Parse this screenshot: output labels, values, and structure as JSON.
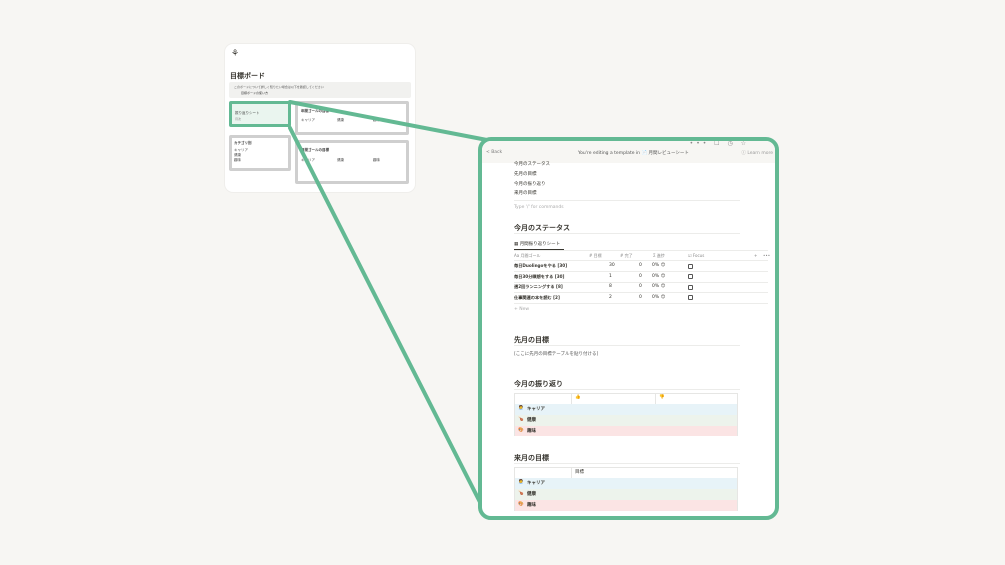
{
  "thumbnail": {
    "logo": "⚘",
    "title": "目標ボード",
    "callout_text": "このボードについて詳しく知りたい場合は以下を確認してください",
    "callout_link": "目標ボードの使い方",
    "review_label": "振り返りシート",
    "review_sub": "月次",
    "annual_title": "年間ゴールの目標",
    "category_title": "カテゴリ別",
    "annual_items": [
      "キャリア",
      "健康",
      "趣味"
    ],
    "category_items": [
      "キャリア",
      "健康",
      "趣味"
    ],
    "monthly_title": "月間ゴールの目標"
  },
  "zoom": {
    "topbar": {
      "icons": "•••  ☐  ◷  ☆",
      "back": "< Back",
      "notice_prefix": "You're editing a template in",
      "template_icon": "📄",
      "template_name": "月間レビューシート",
      "learn_more": "ⓘ Learn more"
    },
    "toc": [
      "今月のステータス",
      "先月の目標",
      "今月の振り返り",
      "来月の目標"
    ],
    "command_placeholder": "Type '/' for commands",
    "status_section": {
      "heading": "今月のステータス",
      "tab_label": "月間振り返りシート",
      "columns": [
        "Aa 月間ゴール",
        "# 目標",
        "# 完了",
        "Σ 進捗",
        "☑ Focus"
      ],
      "rows": [
        {
          "goal": "毎日Duolingoをやる [30]",
          "target": "30",
          "done": "0",
          "progress": "0% 😊"
        },
        {
          "goal": "毎日30分瞑想をする [30]",
          "target": "1",
          "done": "0",
          "progress": "0% 😊"
        },
        {
          "goal": "週2回ランニングする [8]",
          "target": "8",
          "done": "0",
          "progress": "0% 😊"
        },
        {
          "goal": "仕事関連の本を読む [2]",
          "target": "2",
          "done": "0",
          "progress": "0% 😊"
        }
      ],
      "new_label": "+ New",
      "add_col": "+",
      "more": "•••"
    },
    "last_month": {
      "heading": "先月の目標",
      "placeholder": "[ここに先月の目標テーブルを貼り付ける]"
    },
    "reflection": {
      "heading": "今月の振り返り",
      "col_good": "👍",
      "col_bad": "👎",
      "rows": [
        {
          "icon": "🧑‍💼",
          "label": "キャリア"
        },
        {
          "icon": "🍗",
          "label": "健康"
        },
        {
          "icon": "🎨",
          "label": "趣味"
        }
      ]
    },
    "next_month": {
      "heading": "来月の目標",
      "col_goal": "目標",
      "rows": [
        {
          "icon": "🧑‍💼",
          "label": "キャリア"
        },
        {
          "icon": "🍗",
          "label": "健康"
        },
        {
          "icon": "🎨",
          "label": "趣味"
        }
      ]
    }
  },
  "colors": {
    "accent_green": "#63b993",
    "row_blue": "#e7f3f8",
    "row_green": "#edf3ec",
    "row_red": "#fbe4e4"
  }
}
